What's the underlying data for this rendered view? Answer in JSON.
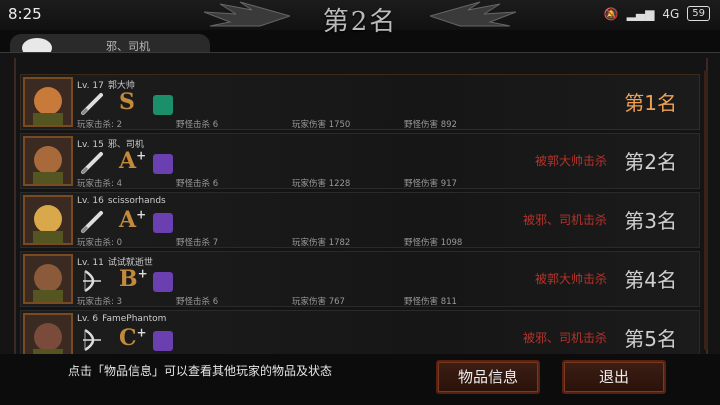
{
  "status": {
    "time": "8:25",
    "network": "4G",
    "battery": "59"
  },
  "header": {
    "title": "第2名",
    "peek_name": "邪、司机"
  },
  "players": [
    {
      "level": "Lv. 17",
      "name": "郭大帅",
      "grade": "S",
      "plus": "",
      "killed_by": "",
      "rank": "第1名",
      "player_kills": "玩家击杀: 2",
      "monster_kills": "野怪击杀 6",
      "player_damage": "玩家伤害 1750",
      "monster_damage": "野怪伤害 892",
      "weapon": "bat-icon",
      "gem_color": "#1b8f6a"
    },
    {
      "level": "Lv. 15",
      "name": "邪、司机",
      "grade": "A",
      "plus": "+",
      "killed_by": "被郭大帅击杀",
      "rank": "第2名",
      "player_kills": "玩家击杀: 4",
      "monster_kills": "野怪击杀 6",
      "player_damage": "玩家伤害 1228",
      "monster_damage": "野怪伤害 917",
      "weapon": "bat-icon",
      "gem_color": "#6a3fb0"
    },
    {
      "level": "Lv. 16",
      "name": "scissorhands",
      "grade": "A",
      "plus": "+",
      "killed_by": "被邪、司机击杀",
      "rank": "第3名",
      "player_kills": "玩家击杀: 0",
      "monster_kills": "野怪击杀 7",
      "player_damage": "玩家伤害 1782",
      "monster_damage": "野怪伤害 1098",
      "weapon": "bat-icon",
      "gem_color": "#6a3fb0"
    },
    {
      "level": "Lv. 11",
      "name": "试试就逝世",
      "grade": "B",
      "plus": "+",
      "killed_by": "被郭大帅击杀",
      "rank": "第4名",
      "player_kills": "玩家击杀: 3",
      "monster_kills": "野怪击杀 6",
      "player_damage": "玩家伤害 767",
      "monster_damage": "野怪伤害 811",
      "weapon": "bow-icon",
      "gem_color": "#6a3fb0"
    },
    {
      "level": "Lv. 6",
      "name": "FamePhantom",
      "grade": "C",
      "plus": "+",
      "killed_by": "被邪、司机击杀",
      "rank": "第5名",
      "player_kills": "",
      "monster_kills": "",
      "player_damage": "",
      "monster_damage": "",
      "weapon": "bow-icon",
      "gem_color": "#6a3fb0"
    }
  ],
  "footer": {
    "hint": "点击「物品信息」可以查看其他玩家的物品及状态",
    "info_button": "物品信息",
    "exit_button": "退出"
  }
}
